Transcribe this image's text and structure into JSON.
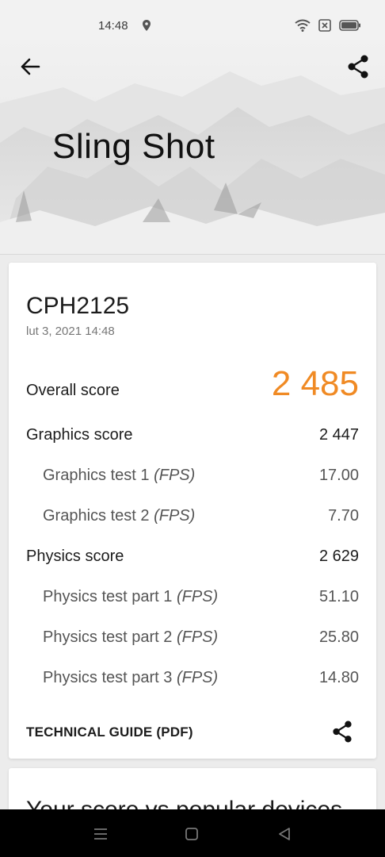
{
  "status_bar": {
    "time": "14:48",
    "icons": [
      "location-icon",
      "wifi-icon",
      "sim-icon",
      "battery-icon"
    ]
  },
  "header": {
    "title": "Sling Shot",
    "back_icon": "arrow-left-icon",
    "share_icon": "share-icon"
  },
  "result": {
    "device": "CPH2125",
    "date": "lut 3, 2021 14:48",
    "overall_label": "Overall score",
    "overall_value": "2 485",
    "graphics_label": "Graphics score",
    "graphics_value": "2 447",
    "graphics_test1_label": "Graphics test 1 ",
    "graphics_test1_value": "17.00",
    "graphics_test2_label": "Graphics test 2 ",
    "graphics_test2_value": "7.70",
    "physics_label": "Physics score",
    "physics_value": "2 629",
    "physics_test1_label": "Physics test part 1 ",
    "physics_test1_value": "51.10",
    "physics_test2_label": "Physics test part 2 ",
    "physics_test2_value": "25.80",
    "physics_test3_label": "Physics test part 3 ",
    "physics_test3_value": "14.80",
    "unit": "(FPS)",
    "technical_guide": "TECHNICAL GUIDE (PDF)"
  },
  "comparison": {
    "title": "Your score vs popular devices"
  },
  "colors": {
    "accent": "#f08a24"
  }
}
